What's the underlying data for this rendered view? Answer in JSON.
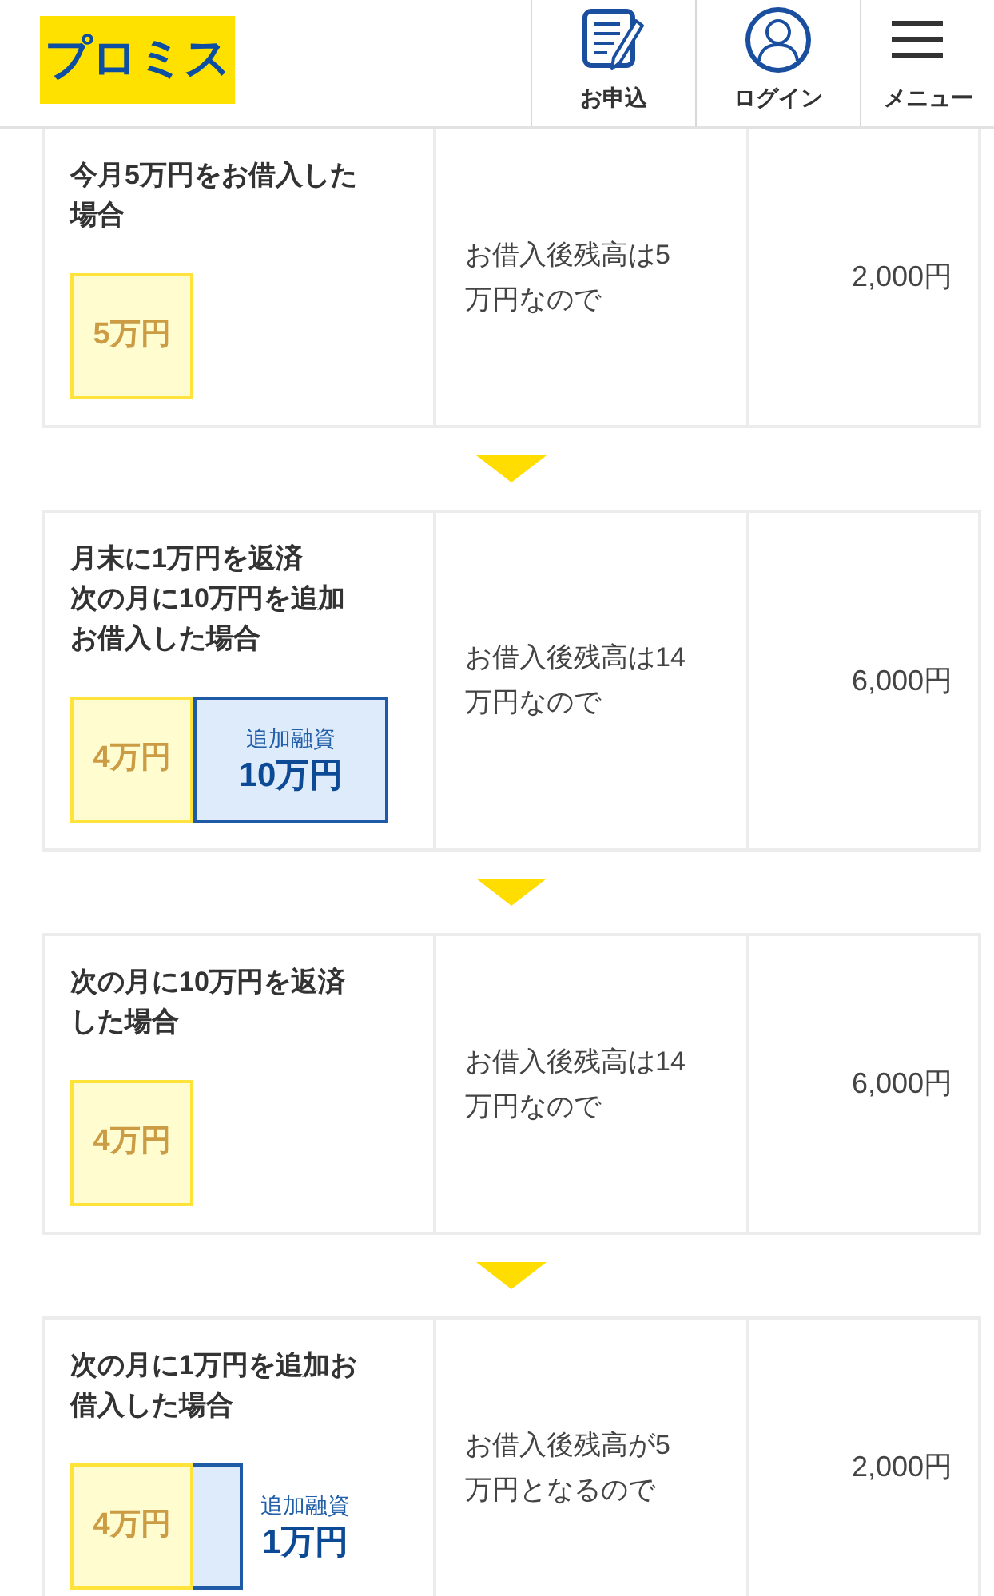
{
  "header": {
    "logo": "プロミス",
    "nav": [
      {
        "kind": "apply",
        "label": "お申込"
      },
      {
        "kind": "login",
        "label": "ログイン"
      },
      {
        "kind": "menu",
        "label": "メニュー"
      }
    ]
  },
  "steps": [
    {
      "title_lines": [
        "今月5万円をお借入した",
        "場合"
      ],
      "blocks": [
        {
          "kind": "current",
          "amount": "5万円"
        }
      ],
      "balance_lines": [
        "お借入後残高は5",
        "万円なので"
      ],
      "payment": "2,000円"
    },
    {
      "title_lines": [
        "月末に1万円を返済",
        "次の月に10万円を追加",
        "お借入した場合"
      ],
      "blocks": [
        {
          "kind": "current",
          "amount": "4万円"
        },
        {
          "kind": "added",
          "caption": "追加融資",
          "amount": "10万円"
        }
      ],
      "balance_lines": [
        "お借入後残高は14",
        "万円なので"
      ],
      "payment": "6,000円"
    },
    {
      "title_lines": [
        "次の月に10万円を返済",
        "した場合"
      ],
      "blocks": [
        {
          "kind": "current",
          "amount": "4万円"
        }
      ],
      "balance_lines": [
        "お借入後残高は14",
        "万円なので"
      ],
      "payment": "6,000円"
    },
    {
      "title_lines": [
        "次の月に1万円を追加お",
        "借入した場合"
      ],
      "blocks": [
        {
          "kind": "current",
          "amount": "4万円"
        },
        {
          "kind": "added_narrow",
          "caption": "追加融資",
          "amount": "1万円"
        }
      ],
      "balance_lines": [
        "お借入後残高が5",
        "万円となるので"
      ],
      "payment": "2,000円"
    }
  ]
}
